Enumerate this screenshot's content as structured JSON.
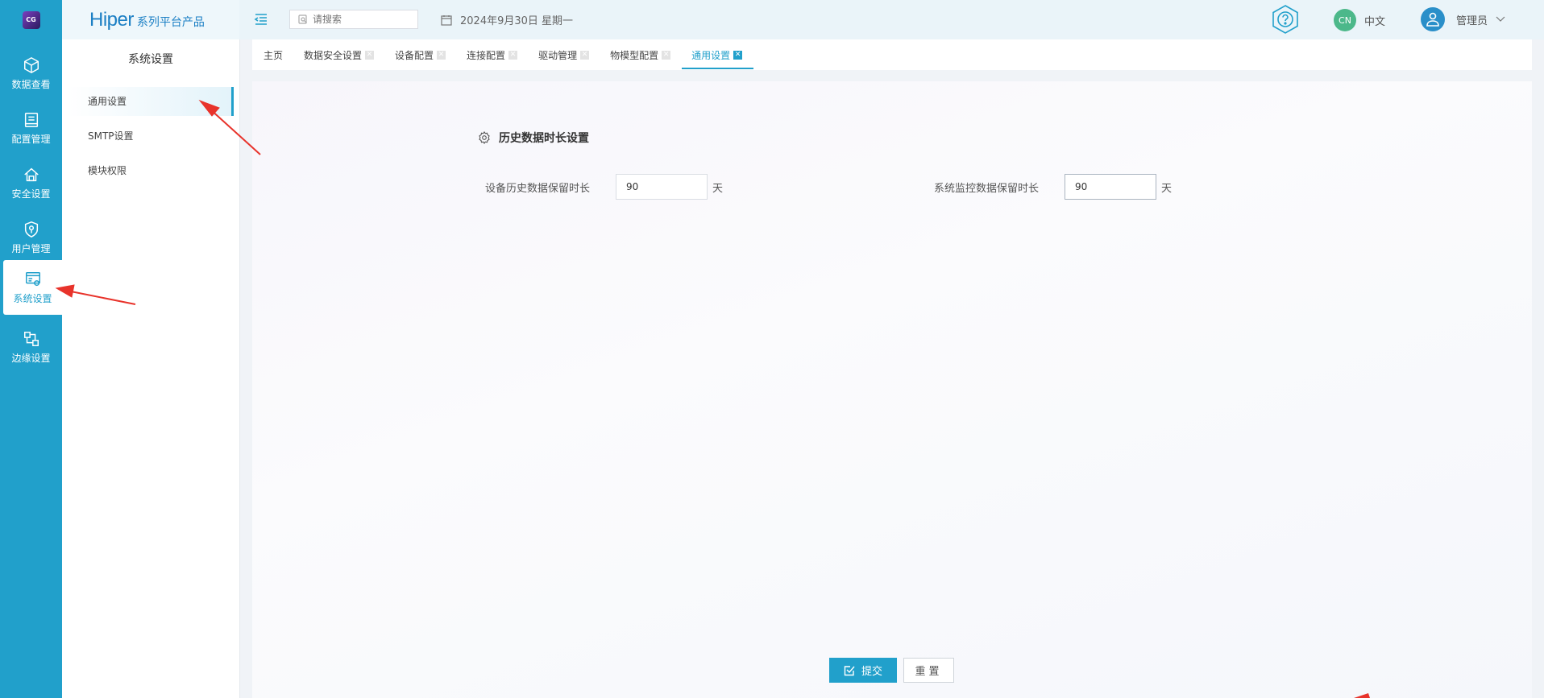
{
  "rail": {
    "logo_text": "CG",
    "items": [
      {
        "label": "数据查看",
        "icon": "cube-icon"
      },
      {
        "label": "配置管理",
        "icon": "config-icon"
      },
      {
        "label": "安全设置",
        "icon": "security-icon"
      },
      {
        "label": "用户管理",
        "icon": "user-shield-icon"
      },
      {
        "label": "系统设置",
        "icon": "system-settings-icon",
        "active": true
      },
      {
        "label": "边缘设置",
        "icon": "edge-icon"
      }
    ]
  },
  "brand": {
    "name": "Hiper",
    "subtitle": "系列平台产品"
  },
  "sidebar": {
    "title": "系统设置",
    "items": [
      {
        "label": "通用设置",
        "active": true
      },
      {
        "label": "SMTP设置"
      },
      {
        "label": "模块权限"
      }
    ]
  },
  "header": {
    "search_placeholder": "请搜索",
    "date": "2024年9月30日 星期一",
    "lang_badge": "CN",
    "lang_label": "中文",
    "user_name": "管理员"
  },
  "tabs": [
    {
      "label": "主页",
      "closable": false
    },
    {
      "label": "数据安全设置",
      "closable": true
    },
    {
      "label": "设备配置",
      "closable": true
    },
    {
      "label": "连接配置",
      "closable": true
    },
    {
      "label": "驱动管理",
      "closable": true
    },
    {
      "label": "物模型配置",
      "closable": true
    },
    {
      "label": "通用设置",
      "closable": true,
      "active": true
    }
  ],
  "form": {
    "section_title": "历史数据时长设置",
    "device_history_label": "设备历史数据保留时长",
    "device_history_value": "90",
    "system_monitor_label": "系统监控数据保留时长",
    "system_monitor_value": "90",
    "unit": "天",
    "submit_label": "提交",
    "reset_label": "重置"
  },
  "colors": {
    "primary": "#21a0cb",
    "annotation": "#e8332b"
  }
}
